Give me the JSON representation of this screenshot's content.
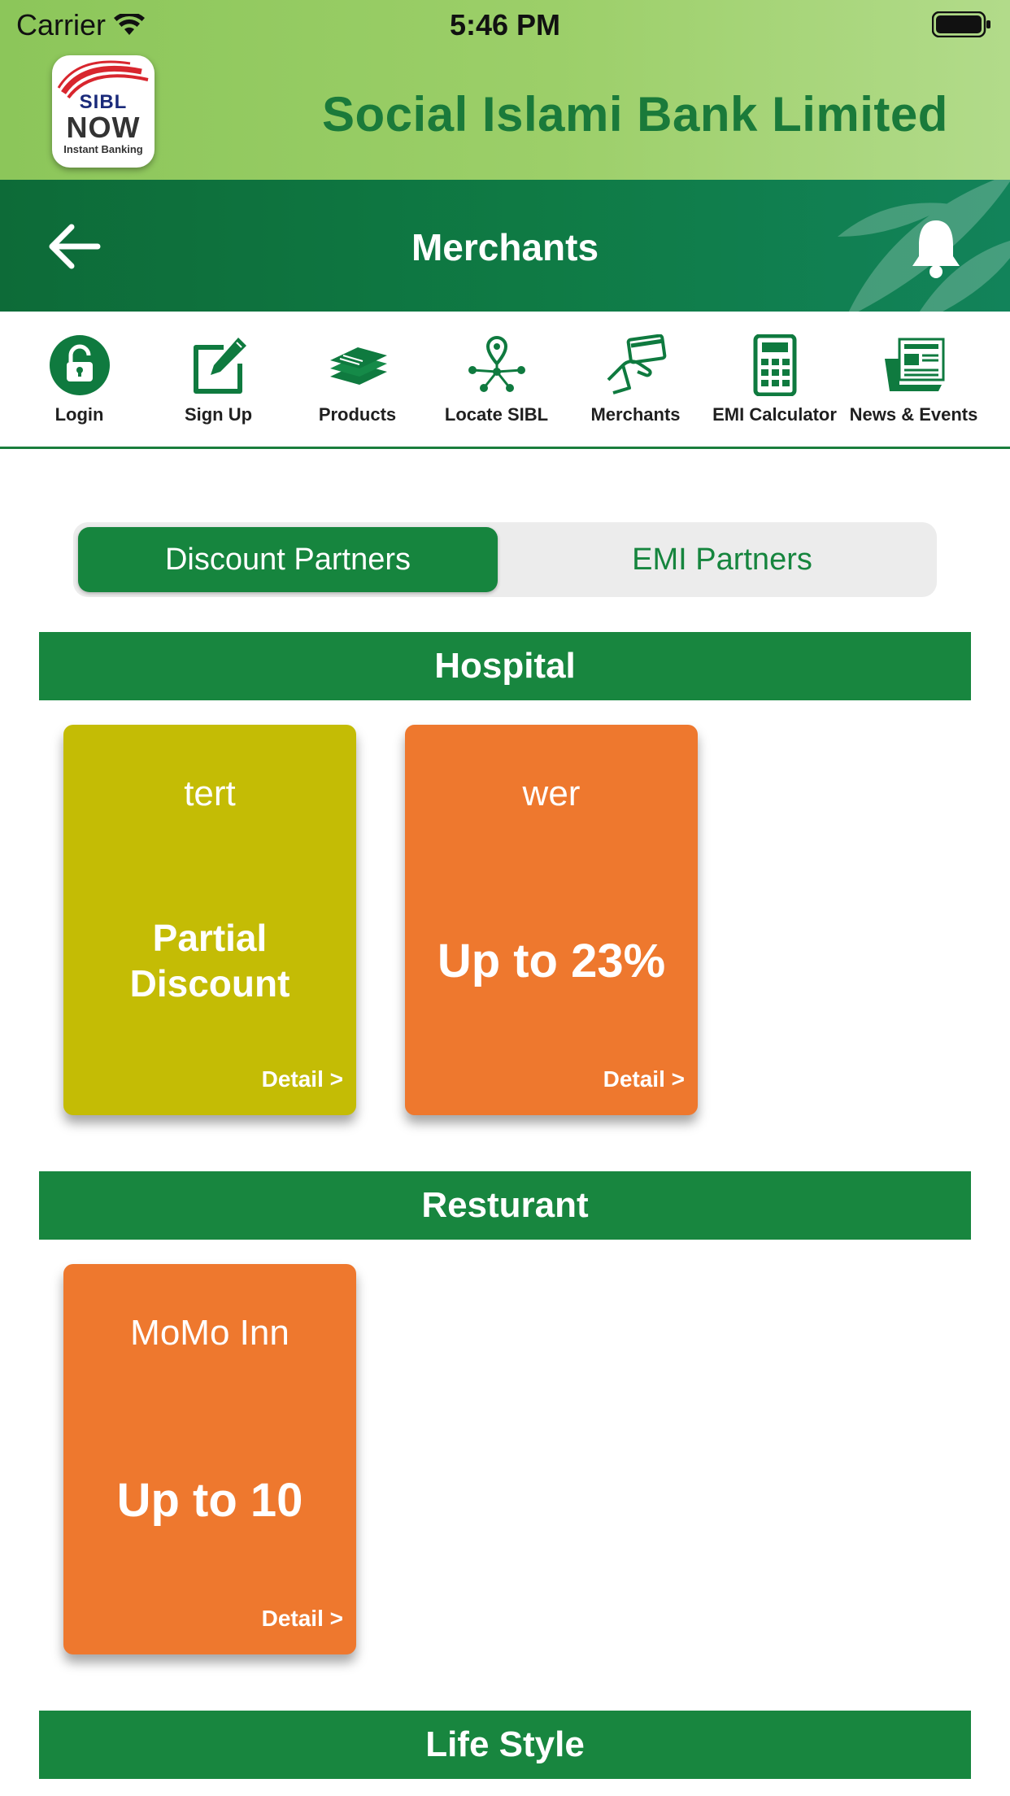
{
  "status_bar": {
    "carrier": "Carrier",
    "time": "5:46 PM"
  },
  "brand": {
    "logo_line1": "SIBL",
    "logo_line2": "NOW",
    "logo_line3": "Instant Banking",
    "bank_name": "Social Islami Bank Limited"
  },
  "navbar": {
    "title": "Merchants",
    "back_icon": "arrow-left-icon",
    "bell_icon": "bell-icon"
  },
  "menu": {
    "items": [
      {
        "label": "Login",
        "icon": "lock-icon"
      },
      {
        "label": "Sign Up",
        "icon": "edit-icon"
      },
      {
        "label": "Products",
        "icon": "stack-icon"
      },
      {
        "label": "Locate SIBL",
        "icon": "location-network-icon"
      },
      {
        "label": "Merchants",
        "icon": "card-hand-icon"
      },
      {
        "label": "EMI Calculator",
        "icon": "calculator-icon"
      },
      {
        "label": "News & Events",
        "icon": "newspaper-icon"
      }
    ]
  },
  "tabs": {
    "active": "Discount Partners",
    "inactive": "EMI Partners"
  },
  "categories": [
    {
      "title": "Hospital",
      "cards": [
        {
          "name": "tert",
          "offer": "Partial Discount",
          "detail": "Detail >",
          "color": "#c4bc05"
        },
        {
          "name": "wer",
          "offer": "Up to 23%",
          "detail": "Detail >",
          "color": "#ee782e"
        }
      ]
    },
    {
      "title": "Resturant",
      "cards": [
        {
          "name": "MoMo Inn",
          "offer": "Up to 10",
          "detail": "Detail >",
          "color": "#ee782e"
        }
      ]
    },
    {
      "title": "Life Style",
      "cards": []
    }
  ],
  "colors": {
    "primary_green": "#18863f",
    "header_light_green": "#9ccf69",
    "orange_card": "#ee782e",
    "olive_card": "#c4bc05"
  }
}
